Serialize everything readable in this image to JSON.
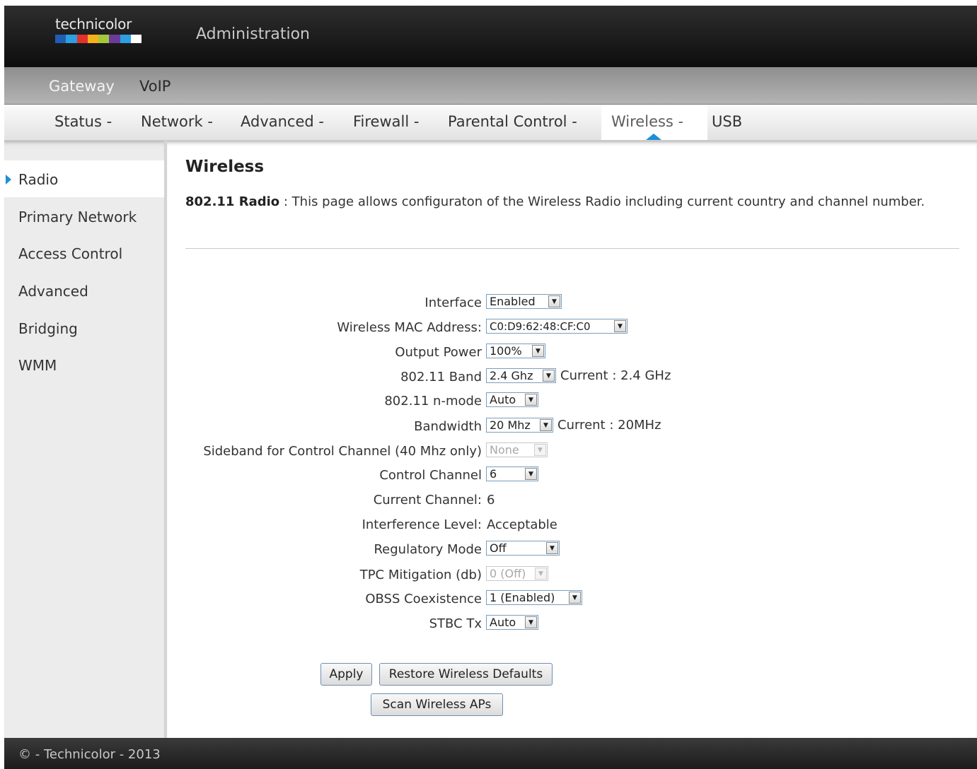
{
  "header": {
    "logo_text": "technicolor",
    "logo_colors": [
      "#1f5fb3",
      "#2e9fe0",
      "#e3312c",
      "#f7b21b",
      "#a3c83b",
      "#6b3b9c",
      "#ffffff"
    ],
    "title": "Administration"
  },
  "product_menu": [
    {
      "label": "Gateway",
      "active": true
    },
    {
      "label": "VoIP",
      "active": false
    }
  ],
  "section_menu": [
    {
      "label": "Status -"
    },
    {
      "label": "Network -"
    },
    {
      "label": "Advanced -"
    },
    {
      "label": "Firewall -"
    },
    {
      "label": "Parental Control -"
    },
    {
      "label": "Wireless -",
      "active": true
    },
    {
      "label": "USB"
    }
  ],
  "sidebar": [
    {
      "label": "Radio",
      "active": true
    },
    {
      "label": "Primary Network"
    },
    {
      "label": "Access Control"
    },
    {
      "label": "Advanced"
    },
    {
      "label": "Bridging"
    },
    {
      "label": "WMM"
    }
  ],
  "page": {
    "title": "Wireless",
    "desc_bold": "802.11 Radio",
    "desc_text": " :  This page allows configuraton of the Wireless Radio including current country and channel number."
  },
  "form": {
    "interface": {
      "label": "Interface",
      "value": "Enabled"
    },
    "mac": {
      "label": "Wireless MAC Address:",
      "value": "C0:D9:62:48:CF:C0"
    },
    "output_power": {
      "label": "Output Power",
      "value": "100%"
    },
    "band": {
      "label": "802.11 Band",
      "value": "2.4 Ghz",
      "current": "Current :  2.4 GHz"
    },
    "nmode": {
      "label": "802.11 n-mode",
      "value": "Auto"
    },
    "bandwidth": {
      "label": "Bandwidth",
      "value": "20 Mhz",
      "current": "Current :  20MHz"
    },
    "sideband": {
      "label": "Sideband for Control Channel (40 Mhz only)",
      "value": "None"
    },
    "control_channel": {
      "label": "Control Channel",
      "value": "6"
    },
    "current_channel": {
      "label": "Current Channel:",
      "value": "6"
    },
    "interference": {
      "label": "Interference Level:",
      "value": "Acceptable"
    },
    "regulatory": {
      "label": "Regulatory Mode",
      "value": "Off"
    },
    "tpc": {
      "label": "TPC Mitigation (db)",
      "value": "0 (Off)"
    },
    "obss": {
      "label": "OBSS Coexistence",
      "value": "1 (Enabled)"
    },
    "stbc": {
      "label": "STBC Tx",
      "value": "Auto"
    }
  },
  "buttons": {
    "apply": "Apply",
    "restore": "Restore Wireless Defaults",
    "scan": "Scan Wireless APs"
  },
  "footer": {
    "text": "© - Technicolor - 2013"
  },
  "icons": {
    "dropdown": "▼"
  }
}
